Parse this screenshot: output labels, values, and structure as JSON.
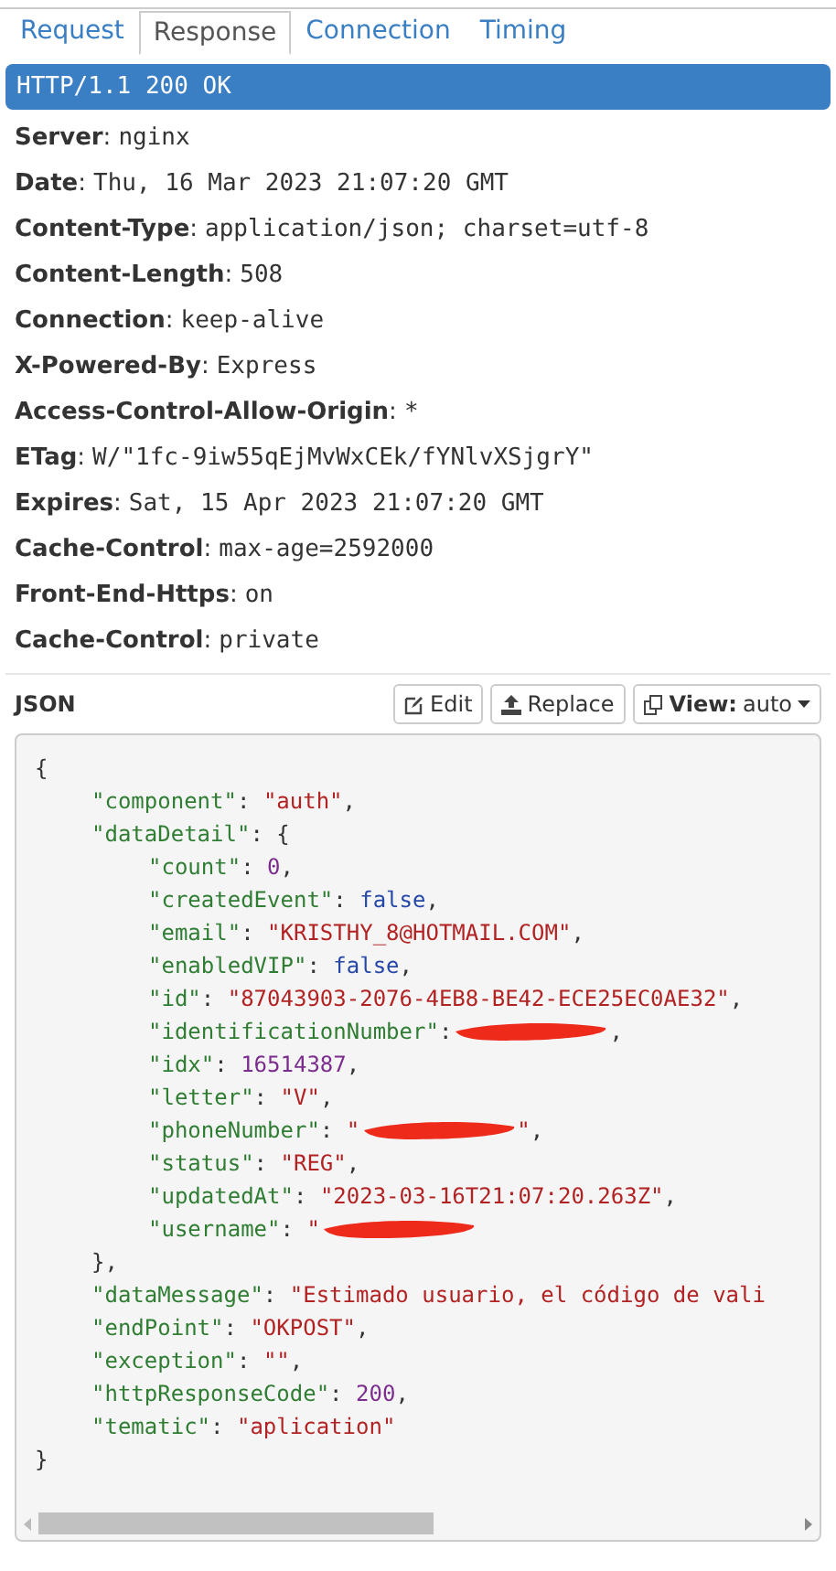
{
  "tabs": [
    {
      "label": "Request",
      "selected": false
    },
    {
      "label": "Response",
      "selected": true
    },
    {
      "label": "Connection",
      "selected": false
    },
    {
      "label": "Timing",
      "selected": false
    }
  ],
  "status_line": "HTTP/1.1 200 OK",
  "headers": [
    {
      "name": "Server",
      "separator": ":",
      "value": "nginx"
    },
    {
      "name": "Date",
      "separator": ":",
      "value": "Thu, 16 Mar 2023 21:07:20 GMT"
    },
    {
      "name": "Content-Type",
      "separator": ":",
      "value": "application/json; charset=utf-8"
    },
    {
      "name": "Content-Length",
      "separator": ":",
      "value": "508"
    },
    {
      "name": "Connection",
      "separator": ":",
      "value": "keep-alive"
    },
    {
      "name": "X-Powered-By",
      "separator": ":",
      "value": "Express"
    },
    {
      "name": "Access-Control-Allow-Origin",
      "separator": ":",
      "value": "*"
    },
    {
      "name": "ETag",
      "separator": ":",
      "value": "W/\"1fc-9iw55qEjMvWxCEk/fYNlvXSjgrY\""
    },
    {
      "name": "Expires",
      "separator": ":",
      "value": "Sat, 15 Apr 2023 21:07:20 GMT"
    },
    {
      "name": "Cache-Control",
      "separator": ":",
      "value": "max-age=2592000"
    },
    {
      "name": "Front-End-Https",
      "separator": ":",
      "value": "on"
    },
    {
      "name": "Cache-Control",
      "separator": ":",
      "value": "private"
    }
  ],
  "body_section": {
    "title": "JSON",
    "buttons": [
      {
        "kind": "edit",
        "label": "Edit"
      },
      {
        "kind": "replace",
        "label": "Replace"
      },
      {
        "kind": "view",
        "label": "View:",
        "value": "auto"
      }
    ],
    "open": "{",
    "entries": [
      {
        "tokens": [
          {
            "kind": "key",
            "text": "\"component\""
          },
          {
            "kind": "punct",
            "text": ": "
          },
          {
            "kind": "string",
            "text": "\"auth\""
          },
          {
            "kind": "punct",
            "text": ","
          }
        ]
      },
      {
        "tokens": [
          {
            "kind": "key",
            "text": "\"dataDetail\""
          },
          {
            "kind": "punct",
            "text": ": {"
          }
        ],
        "children": [
          {
            "tokens": [
              {
                "kind": "key",
                "text": "\"count\""
              },
              {
                "kind": "punct",
                "text": ": "
              },
              {
                "kind": "number",
                "text": "0"
              },
              {
                "kind": "punct",
                "text": ","
              }
            ]
          },
          {
            "tokens": [
              {
                "kind": "key",
                "text": "\"createdEvent\""
              },
              {
                "kind": "punct",
                "text": ": "
              },
              {
                "kind": "literal",
                "text": "false"
              },
              {
                "kind": "punct",
                "text": ","
              }
            ]
          },
          {
            "tokens": [
              {
                "kind": "key",
                "text": "\"email\""
              },
              {
                "kind": "punct",
                "text": ": "
              },
              {
                "kind": "string",
                "text": "\"KRISTHY_8@HOTMAIL.COM\""
              },
              {
                "kind": "punct",
                "text": ","
              }
            ]
          },
          {
            "tokens": [
              {
                "kind": "key",
                "text": "\"enabledVIP\""
              },
              {
                "kind": "punct",
                "text": ": "
              },
              {
                "kind": "literal",
                "text": "false"
              },
              {
                "kind": "punct",
                "text": ","
              }
            ]
          },
          {
            "tokens": [
              {
                "kind": "key",
                "text": "\"id\""
              },
              {
                "kind": "punct",
                "text": ": "
              },
              {
                "kind": "string",
                "text": "\"87043903-2076-4EB8-BE42-ECE25EC0AE32\""
              },
              {
                "kind": "punct",
                "text": ","
              }
            ]
          },
          {
            "tokens": [
              {
                "kind": "key",
                "text": "\"identificationNumber\""
              },
              {
                "kind": "punct",
                "text": ":"
              },
              {
                "kind": "redacted"
              },
              {
                "kind": "punct",
                "text": ","
              }
            ]
          },
          {
            "tokens": [
              {
                "kind": "key",
                "text": "\"idx\""
              },
              {
                "kind": "punct",
                "text": ": "
              },
              {
                "kind": "number",
                "text": "16514387"
              },
              {
                "kind": "punct",
                "text": ","
              }
            ]
          },
          {
            "tokens": [
              {
                "kind": "key",
                "text": "\"letter\""
              },
              {
                "kind": "punct",
                "text": ": "
              },
              {
                "kind": "string",
                "text": "\"V\""
              },
              {
                "kind": "punct",
                "text": ","
              }
            ]
          },
          {
            "tokens": [
              {
                "kind": "key",
                "text": "\"phoneNumber\""
              },
              {
                "kind": "punct",
                "text": ": "
              },
              {
                "kind": "string",
                "text": "\""
              },
              {
                "kind": "redacted"
              },
              {
                "kind": "string",
                "text": "\""
              },
              {
                "kind": "punct",
                "text": ","
              }
            ]
          },
          {
            "tokens": [
              {
                "kind": "key",
                "text": "\"status\""
              },
              {
                "kind": "punct",
                "text": ": "
              },
              {
                "kind": "string",
                "text": "\"REG\""
              },
              {
                "kind": "punct",
                "text": ","
              }
            ]
          },
          {
            "tokens": [
              {
                "kind": "key",
                "text": "\"updatedAt\""
              },
              {
                "kind": "punct",
                "text": ": "
              },
              {
                "kind": "string",
                "text": "\"2023-03-16T21:07:20.263Z\""
              },
              {
                "kind": "punct",
                "text": ","
              }
            ]
          },
          {
            "tokens": [
              {
                "kind": "key",
                "text": "\"username\""
              },
              {
                "kind": "punct",
                "text": ": "
              },
              {
                "kind": "string",
                "text": "\""
              },
              {
                "kind": "redacted"
              }
            ]
          }
        ],
        "close": "},"
      },
      {
        "tokens": [
          {
            "kind": "key",
            "text": "\"dataMessage\""
          },
          {
            "kind": "punct",
            "text": ": "
          },
          {
            "kind": "string",
            "text": "\"Estimado usuario, el código de vali"
          }
        ]
      },
      {
        "tokens": [
          {
            "kind": "key",
            "text": "\"endPoint\""
          },
          {
            "kind": "punct",
            "text": ": "
          },
          {
            "kind": "string",
            "text": "\"OKPOST\""
          },
          {
            "kind": "punct",
            "text": ","
          }
        ]
      },
      {
        "tokens": [
          {
            "kind": "key",
            "text": "\"exception\""
          },
          {
            "kind": "punct",
            "text": ": "
          },
          {
            "kind": "string",
            "text": "\"\""
          },
          {
            "kind": "punct",
            "text": ","
          }
        ]
      },
      {
        "tokens": [
          {
            "kind": "key",
            "text": "\"httpResponseCode\""
          },
          {
            "kind": "punct",
            "text": ": "
          },
          {
            "kind": "number",
            "text": "200"
          },
          {
            "kind": "punct",
            "text": ","
          }
        ]
      },
      {
        "tokens": [
          {
            "kind": "key",
            "text": "\"tematic\""
          },
          {
            "kind": "punct",
            "text": ": "
          },
          {
            "kind": "string",
            "text": "\"aplication\""
          }
        ]
      }
    ],
    "close": "}"
  }
}
